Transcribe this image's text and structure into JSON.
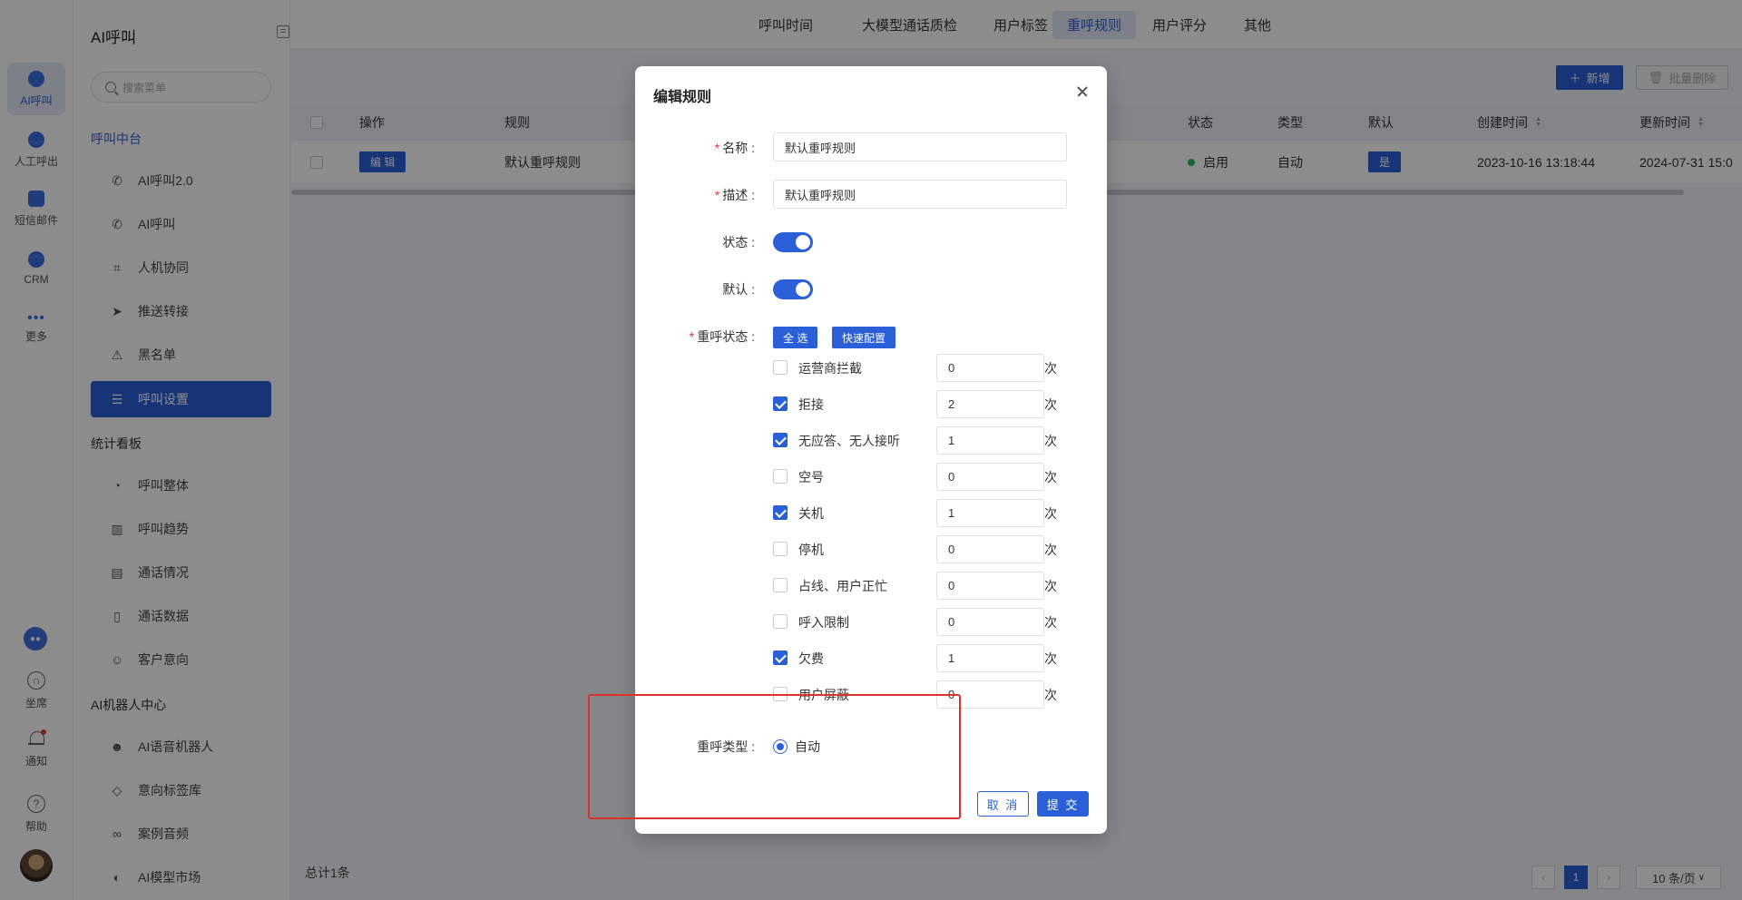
{
  "rail": {
    "items": [
      {
        "label": "AI呼叫"
      },
      {
        "label": "人工呼出"
      },
      {
        "label": "短信邮件"
      },
      {
        "label": "CRM"
      },
      {
        "label": "更多"
      }
    ],
    "bottom": [
      {
        "label": "坐席"
      },
      {
        "label": "通知"
      },
      {
        "label": "帮助"
      }
    ]
  },
  "sidebar": {
    "title": "AI呼叫",
    "search_placeholder": "搜索菜单",
    "groups": [
      {
        "label": "呼叫中台"
      },
      {
        "label": "统计看板"
      },
      {
        "label": "AI机器人中心"
      }
    ],
    "items": [
      {
        "label": "AI呼叫2.0",
        "icon": "phone-call-icon"
      },
      {
        "label": "AI呼叫",
        "icon": "phone-icon"
      },
      {
        "label": "人机协同",
        "icon": "scan-person-icon"
      },
      {
        "label": "推送转接",
        "icon": "send-icon"
      },
      {
        "label": "黑名单",
        "icon": "warning-icon"
      },
      {
        "label": "呼叫设置",
        "icon": "sliders-icon"
      },
      {
        "label": "呼叫整体",
        "icon": "pie-chart-icon"
      },
      {
        "label": "呼叫趋势",
        "icon": "bar-chart-icon"
      },
      {
        "label": "通话情况",
        "icon": "document-icon"
      },
      {
        "label": "通话数据",
        "icon": "file-search-icon"
      },
      {
        "label": "客户意向",
        "icon": "smile-icon"
      },
      {
        "label": "AI语音机器人",
        "icon": "robot-icon"
      },
      {
        "label": "意向标签库",
        "icon": "tag-icon"
      },
      {
        "label": "案例音频",
        "icon": "voicemail-icon"
      },
      {
        "label": "AI模型市场",
        "icon": "market-icon"
      }
    ]
  },
  "tabs": [
    {
      "label": "呼叫时间"
    },
    {
      "label": "大模型通话质检"
    },
    {
      "label": "用户标签"
    },
    {
      "label": "重呼规则"
    },
    {
      "label": "用户评分"
    },
    {
      "label": "其他"
    }
  ],
  "toolbar": {
    "add_label": "新增",
    "bulk_delete_label": "批量删除"
  },
  "table": {
    "headers": [
      "操作",
      "规则",
      "状态",
      "类型",
      "默认",
      "创建时间",
      "更新时间"
    ],
    "rows": [
      {
        "action": "编 辑",
        "rule": "默认重呼规则",
        "status": "启用",
        "type": "自动",
        "default": "是",
        "created": "2023-10-16 13:18:44",
        "updated": "2024-07-31 15:0"
      }
    ]
  },
  "footer": {
    "total": "总计1条",
    "page": "1",
    "page_size": "10 条/页"
  },
  "dialog": {
    "title": "编辑规则",
    "name_label": "名称",
    "name_value": "默认重呼规则",
    "desc_label": "描述",
    "desc_value": "默认重呼规则",
    "status_label": "状态",
    "status_on": true,
    "default_label": "默认",
    "default_on": true,
    "redial_status_label": "重呼状态",
    "select_all_label": "全 选",
    "quick_config_label": "快速配置",
    "unit": "次",
    "statuses": [
      {
        "label": "运营商拦截",
        "checked": false,
        "count": "0"
      },
      {
        "label": "拒接",
        "checked": true,
        "count": "2"
      },
      {
        "label": "无应答、无人接听",
        "checked": true,
        "count": "1"
      },
      {
        "label": "空号",
        "checked": false,
        "count": "0"
      },
      {
        "label": "关机",
        "checked": true,
        "count": "1"
      },
      {
        "label": "停机",
        "checked": false,
        "count": "0"
      },
      {
        "label": "占线、用户正忙",
        "checked": false,
        "count": "0"
      },
      {
        "label": "呼入限制",
        "checked": false,
        "count": "0"
      },
      {
        "label": "欠费",
        "checked": true,
        "count": "1"
      },
      {
        "label": "用户屏蔽",
        "checked": false,
        "count": "0"
      }
    ],
    "redial_type_label": "重呼类型",
    "redial_type_option": "自动",
    "cancel_label": "取 消",
    "submit_label": "提 交"
  },
  "colors": {
    "accent": "#2a5fd7",
    "highlight": "#e0302d",
    "success": "#2dbb5d"
  }
}
